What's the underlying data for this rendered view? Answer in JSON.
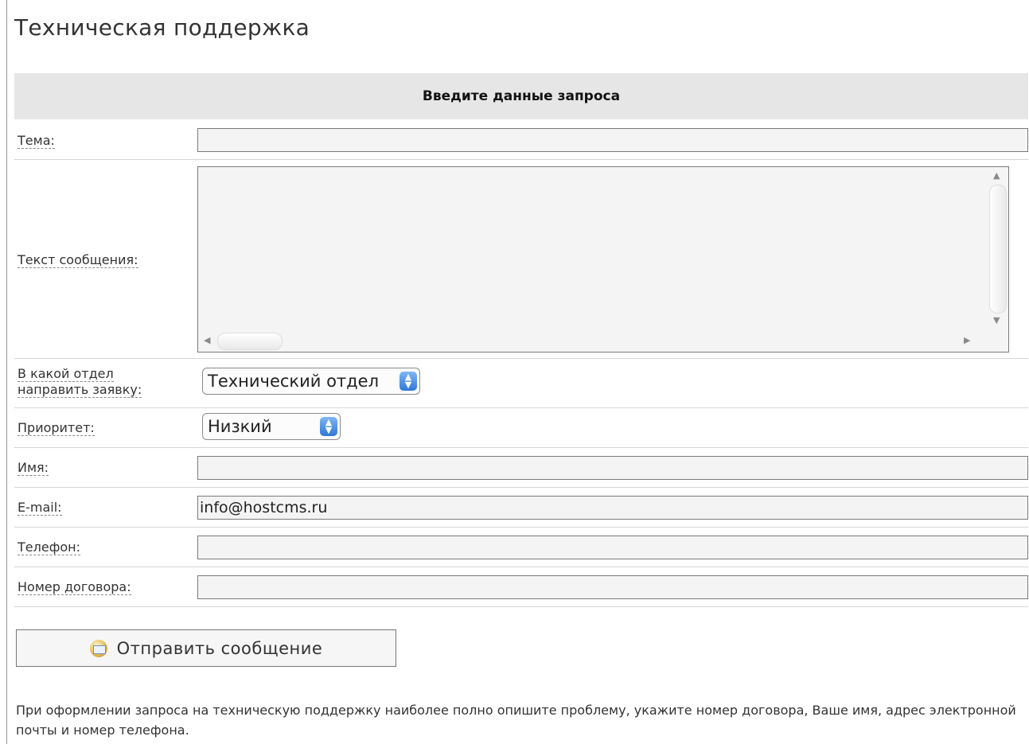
{
  "page_title": "Техническая поддержка",
  "form": {
    "header": "Введите данные запроса",
    "subject_label": "Тема:",
    "subject_value": "",
    "message_label": "Текст сообщения:",
    "message_value": "",
    "department_label_line1": "В какой отдел",
    "department_label_line2": "направить заявку:",
    "department_selected": "Технический отдел",
    "priority_label": "Приоритет:",
    "priority_selected": "Низкий",
    "name_label": "Имя:",
    "name_value": "",
    "email_label": "E-mail:",
    "email_value": "info@hostcms.ru",
    "phone_label": "Телефон:",
    "phone_value": "",
    "contract_label": "Номер договора:",
    "contract_value": "",
    "submit_label": "Отправить сообщение"
  },
  "note": "При оформлении запроса на техническую поддержку наиболее полно опишите проблему, укажите номер договора, Ваше имя, адрес электронной почты и номер телефона.",
  "icons": {
    "submit_icon": "envelope-icon",
    "select_arrows": "updown-stepper-icon"
  }
}
